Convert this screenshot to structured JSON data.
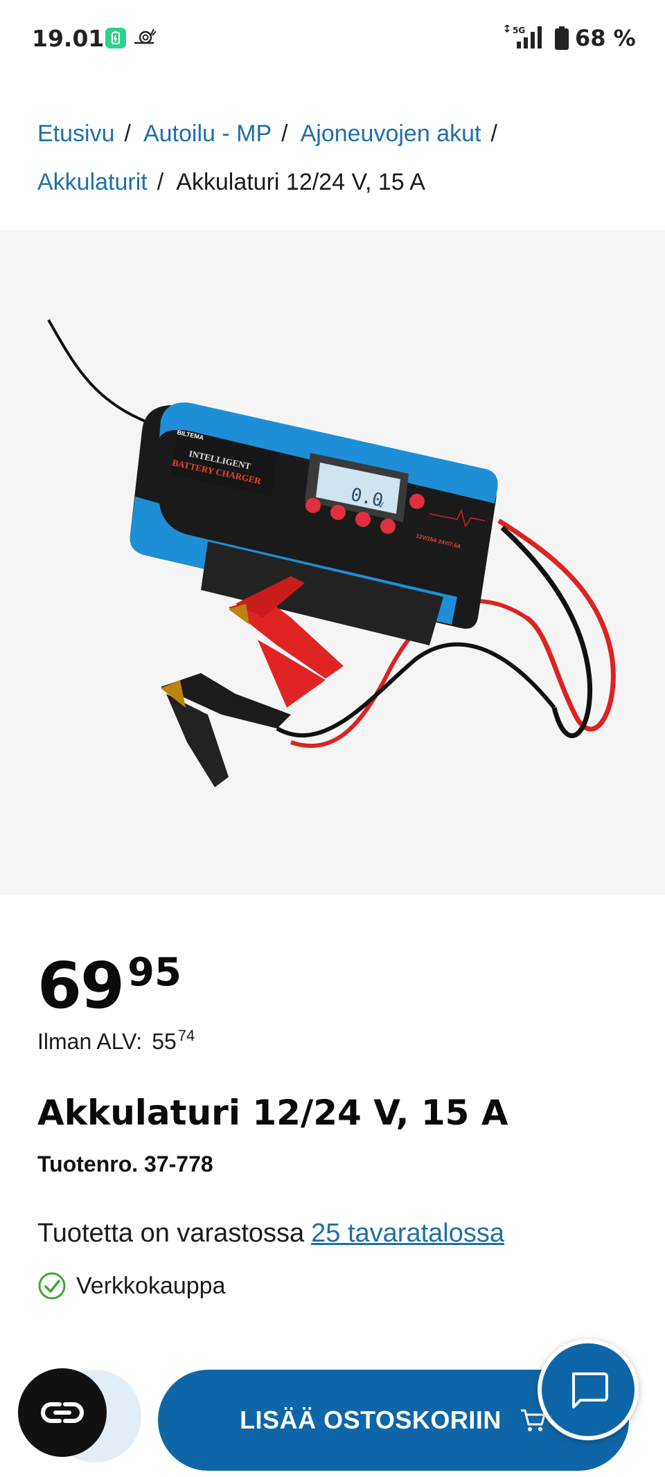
{
  "status_bar": {
    "time": "19.01",
    "network": "5G",
    "battery": "68 %"
  },
  "breadcrumb": {
    "items": [
      {
        "label": "Etusivu"
      },
      {
        "label": "Autoilu - MP"
      },
      {
        "label": "Ajoneuvojen akut"
      },
      {
        "label": "Akkulaturit"
      }
    ],
    "current": "Akkulaturi 12/24 V, 15 A",
    "separator": "/"
  },
  "product_image": {
    "brand_text": "BILTEMA",
    "line1": "INTELLIGENT",
    "line2": "BATTERY CHARGER",
    "display": "0.0",
    "display_unit": "V",
    "spec": "12V/15A 24V/7.5A"
  },
  "price": {
    "integer": "69",
    "decimals": "95"
  },
  "vat": {
    "label": "Ilman ALV:",
    "integer": "55",
    "decimals": "74"
  },
  "product": {
    "title": "Akkulaturi 12/24 V, 15 A",
    "sku": "Tuotenro. 37-778"
  },
  "stock": {
    "text": "Tuotetta on varastossa",
    "link": "25 tavaratalossa"
  },
  "online": {
    "label": "Verkkokauppa"
  },
  "actions": {
    "add_to_cart": "LISÄÄ OSTOSKORIIN"
  },
  "colors": {
    "brand_blue": "#0e66a8",
    "link_blue": "#1f6fa8",
    "check_green": "#3fa535"
  }
}
